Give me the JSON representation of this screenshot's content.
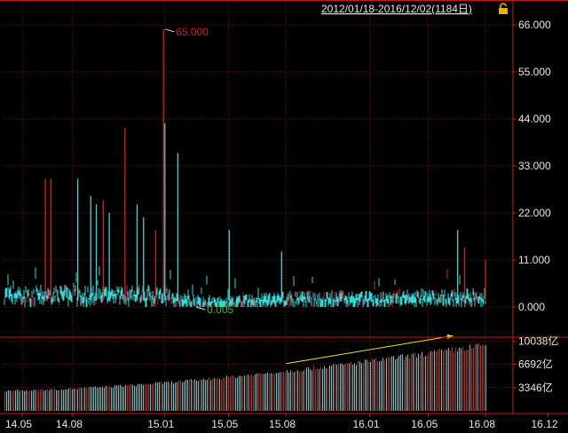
{
  "header": {
    "range_label": "2012/01/18-2016/12/02(1184日)",
    "lock_icon": "lock-icon"
  },
  "colors": {
    "up": "#d0202a",
    "down": "#3cd6d6",
    "grid": "#7a1010",
    "axis": "#c41818",
    "text": "#e6e6e6",
    "trend": "#e6e632",
    "max_label": "#d0202a",
    "min_label": "#30c030"
  },
  "chart_data": [
    {
      "type": "bar",
      "panel": "main",
      "ylim": [
        0,
        66
      ],
      "y_ticks": [
        0,
        11,
        22,
        33,
        44,
        55,
        66
      ],
      "y_tick_labels": [
        "0.000",
        "11.000",
        "22.000",
        "33.000",
        "44.000",
        "55.000",
        "66.000"
      ],
      "grid": true,
      "x_ticks": [
        "14.05",
        "14.08",
        "15.01",
        "15.05",
        "15.08",
        "16.01",
        "16.05",
        "16.08",
        "16.12"
      ],
      "x_tick_positions": [
        0.0,
        0.109,
        0.307,
        0.445,
        0.569,
        0.75,
        0.876,
        1.0,
        1.135
      ],
      "annotations": [
        {
          "text": "65.000",
          "x": 0.305,
          "value": 65.0,
          "kind": "max"
        },
        {
          "text": "0.005",
          "x": 0.372,
          "value": 0.005,
          "kind": "min"
        }
      ],
      "spikes": [
        {
          "x": 0.05,
          "value": 30.0,
          "color": "up"
        },
        {
          "x": 0.062,
          "value": 30.0,
          "color": "up"
        },
        {
          "x": 0.12,
          "value": 30.0,
          "color": "down"
        },
        {
          "x": 0.148,
          "value": 26.0,
          "color": "down"
        },
        {
          "x": 0.16,
          "value": 24.0,
          "color": "down"
        },
        {
          "x": 0.175,
          "value": 25.0,
          "color": "up"
        },
        {
          "x": 0.188,
          "value": 22.0,
          "color": "down"
        },
        {
          "x": 0.222,
          "value": 42.0,
          "color": "up"
        },
        {
          "x": 0.248,
          "value": 24.0,
          "color": "down"
        },
        {
          "x": 0.262,
          "value": 21.0,
          "color": "down"
        },
        {
          "x": 0.288,
          "value": 18.0,
          "color": "up"
        },
        {
          "x": 0.305,
          "value": 65.0,
          "color": "up"
        },
        {
          "x": 0.308,
          "value": 43.0,
          "color": "down"
        },
        {
          "x": 0.336,
          "value": 36.0,
          "color": "down"
        },
        {
          "x": 0.447,
          "value": 18.0,
          "color": "down"
        },
        {
          "x": 0.56,
          "value": 13.0,
          "color": "down"
        },
        {
          "x": 0.94,
          "value": 18.0,
          "color": "down"
        },
        {
          "x": 0.955,
          "value": 14.0,
          "color": "up"
        },
        {
          "x": 1.0,
          "value": 11.0,
          "color": "up"
        }
      ]
    },
    {
      "type": "bar",
      "panel": "sub",
      "y_ticks": [
        3346,
        6692,
        10038
      ],
      "y_tick_labels": [
        "3346亿",
        "6692亿",
        "10038亿"
      ],
      "ylim": [
        0,
        10600
      ],
      "grid": true,
      "start_value": 3000,
      "end_value": 9800,
      "trend": {
        "from_x": 0.57,
        "from_value": 6800,
        "to_x": 0.93,
        "to_value": 10800
      }
    }
  ]
}
